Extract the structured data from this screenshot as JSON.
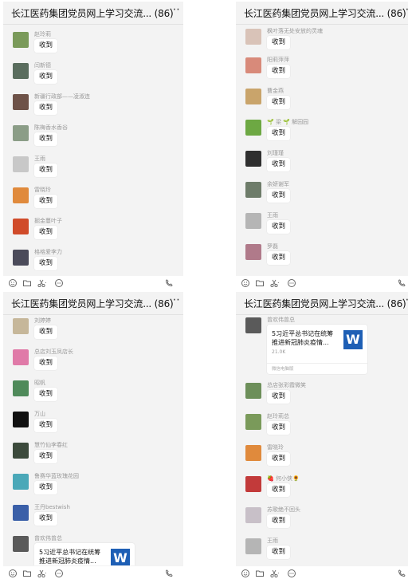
{
  "chat_title": "长江医药集团党员网上学习交流... (86)",
  "more_icon": "⋯",
  "file_icon_letter": "W",
  "toolbar_icons": [
    "emoji-icon",
    "folder-icon",
    "scissors-icon",
    "chat-bubble-icon",
    "call-icon"
  ],
  "panels": [
    {
      "messages": [
        {
          "sender": "赵玲莉",
          "text": "收到",
          "avatar": "#7a9a5a"
        },
        {
          "sender": "闫新德",
          "text": "收到",
          "avatar": "#5a6d5e"
        },
        {
          "sender": "新疆行政部——凌淑连",
          "text": "收到",
          "avatar": "#6e5248"
        },
        {
          "sender": "陈梅香水香谷",
          "text": "收到",
          "avatar": "#8b9d87"
        },
        {
          "sender": "王雨",
          "text": "收到",
          "avatar": "#c8c8c8"
        },
        {
          "sender": "雷晓玲",
          "text": "收到",
          "avatar": "#e08a3c"
        },
        {
          "sender": "掘金蔓叶子",
          "text": "收到",
          "avatar": "#d04b2a"
        },
        {
          "sender": "格格爱李力",
          "text": "收到",
          "avatar": "#4b4b5a"
        }
      ]
    },
    {
      "messages": [
        {
          "sender": "枫叶落无处安放的灵魂",
          "text": "收到",
          "avatar": "#d9c3b8"
        },
        {
          "sender": "阳莉萍萍",
          "text": "收到",
          "avatar": "#d88a7a"
        },
        {
          "sender": "曹金燕",
          "text": "收到",
          "avatar": "#c9a46b"
        },
        {
          "sender": "🌱 梁 🌱 解园园",
          "text": "收到",
          "avatar": "#6da843"
        },
        {
          "sender": "刘瑾瑾",
          "text": "收到",
          "avatar": "#2f2f2f"
        },
        {
          "sender": "余妍谢军",
          "text": "收到",
          "avatar": "#6e7c6a"
        },
        {
          "sender": "王雨",
          "text": "收到",
          "avatar": "#b5b5b5"
        },
        {
          "sender": "罗磊",
          "text": "收到",
          "avatar": "#b07a8a"
        }
      ]
    },
    {
      "messages": [
        {
          "sender": "刘婷婷",
          "text": "收到",
          "avatar": "#c6b79a"
        },
        {
          "sender": "总店刘玉凤店长",
          "text": "收到",
          "avatar": "#e07aa8"
        },
        {
          "sender": "昭帆",
          "text": "收到",
          "avatar": "#4f8a5a"
        },
        {
          "sender": "万山",
          "text": "收到",
          "avatar": "#111111"
        },
        {
          "sender": "慧竹仙李春红",
          "text": "收到",
          "avatar": "#3c4a3c"
        },
        {
          "sender": "鲁赛华蓝玫瑰花园",
          "text": "收到",
          "avatar": "#4aa8b8"
        },
        {
          "sender": "王丹bestwish",
          "text": "收到",
          "avatar": "#3a5fa8"
        },
        {
          "sender": "曾欢伟曾总",
          "text": "",
          "avatar": "#5a5a5a"
        }
      ],
      "file": {
        "msg_index": 7,
        "title": "5习近平总书记在统筹推进新冠肺炎疫情...",
        "size": "",
        "footer": ""
      }
    },
    {
      "messages": [
        {
          "sender": "曾欢伟曾总",
          "text": "",
          "avatar": "#5a5a5a"
        },
        {
          "sender": "总店张彩霞微笑",
          "text": "收到",
          "avatar": "#6d8f5a"
        },
        {
          "sender": "赵玲莉总",
          "text": "收到",
          "avatar": "#7a9a5a"
        },
        {
          "sender": "雷晓玲",
          "text": "收到",
          "avatar": "#e08a3c"
        },
        {
          "sender": "🍓 何小侠🌻",
          "text": "收到",
          "avatar": "#c23a3a"
        },
        {
          "sender": "苏歌绝不回头",
          "text": "收到",
          "avatar": "#c8c0c8"
        },
        {
          "sender": "王雨",
          "text": "收到",
          "avatar": "#b5b5b5"
        }
      ],
      "file": {
        "msg_index": 0,
        "title": "5习近平总书记在统筹推进新冠肺炎疫情...",
        "size": "21.0K",
        "footer": "微信电脑版"
      }
    }
  ]
}
